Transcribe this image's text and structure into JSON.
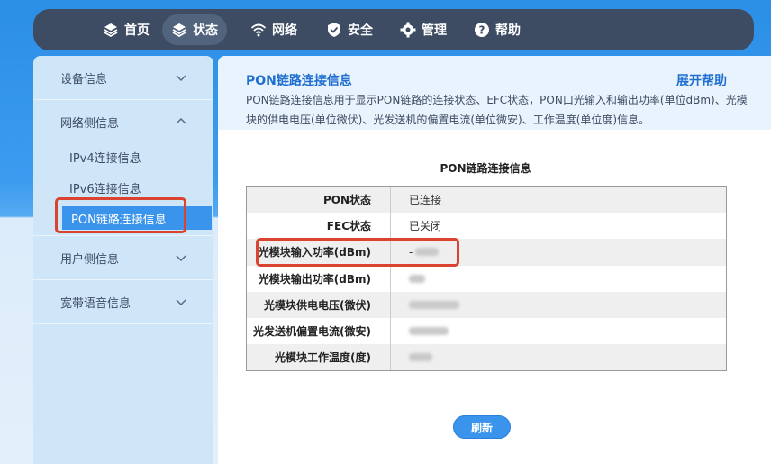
{
  "nav": {
    "items": [
      {
        "label": "首页",
        "icon": "layers-icon"
      },
      {
        "label": "状态",
        "icon": "layers-icon",
        "active": true
      },
      {
        "label": "网络",
        "icon": "wifi-icon"
      },
      {
        "label": "安全",
        "icon": "shield-icon"
      },
      {
        "label": "管理",
        "icon": "gear-icon"
      },
      {
        "label": "帮助",
        "icon": "question-icon"
      }
    ]
  },
  "sidebar": {
    "groups": [
      {
        "label": "设备信息",
        "expanded": false
      },
      {
        "label": "网络侧信息",
        "expanded": true,
        "subitems": [
          "IPv4连接信息",
          "IPv6连接信息",
          "PON链路连接信息"
        ]
      },
      {
        "label": "用户侧信息",
        "expanded": false
      },
      {
        "label": "宽带语音信息",
        "expanded": false
      }
    ],
    "active_sub": "PON链路连接信息"
  },
  "content": {
    "title": "PON链路连接信息",
    "help_link": "展开帮助",
    "description": "PON链路连接信息用于显示PON链路的连接状态、EFC状态，PON口光输入和输出功率(单位dBm)、光模块的供电电压(单位微伏)、光发送机的偏置电流(单位微安)、工作温度(单位度)信息。",
    "table_caption": "PON链路连接信息",
    "rows": [
      {
        "key": "PON状态",
        "value": "已连接"
      },
      {
        "key": "FEC状态",
        "value": "已关闭"
      },
      {
        "key": "光模块输入功率(dBm)",
        "value": "-"
      },
      {
        "key": "光模块输出功率(dBm)",
        "value": ""
      },
      {
        "key": "光模块供电电压(微伏)",
        "value": ""
      },
      {
        "key": "光发送机偏置电流(微安)",
        "value": ""
      },
      {
        "key": "光模块工作温度(度)",
        "value": ""
      }
    ],
    "refresh_label": "刷新"
  },
  "colors": {
    "accent": "#1f6fd1",
    "nav_bg": "#3d4c62",
    "highlight": "#d9432f",
    "button": "#3a94ec"
  }
}
